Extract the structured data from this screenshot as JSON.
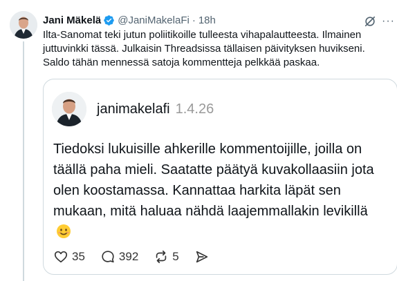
{
  "tweet": {
    "author_name": "Jani Mäkelä",
    "handle": "@JaniMakelaFi",
    "separator": "·",
    "time": "18h",
    "text": "Ilta-Sanomat teki jutun poliitikoille tulleesta vihapalautteesta. Ilmainen juttuvinkki tässä. Julkaisin Threadsissa tällaisen päivityksen huvikseni. Saldo tähän mennessä satoja kommentteja pelkkää paskaa.",
    "more_label": "···"
  },
  "quoted_post": {
    "username": "janimakelafi",
    "date": "1.4.26",
    "text": "Tiedoksi lukuisille ahkerille kommentoijille, joilla on täällä paha mieli. Saatatte päätyä kuvakollaasiin jota olen koostamassa. Kannattaa harkita läpät sen mukaan, mitä haluaa nähdä laajemmallakin levikillä",
    "emoji": "smiling-face-icon",
    "actions": {
      "likes": "35",
      "replies": "392",
      "reposts": "5"
    }
  },
  "colors": {
    "verified": "#1d9bf0",
    "muted": "#536471",
    "border": "#cfd9de"
  }
}
